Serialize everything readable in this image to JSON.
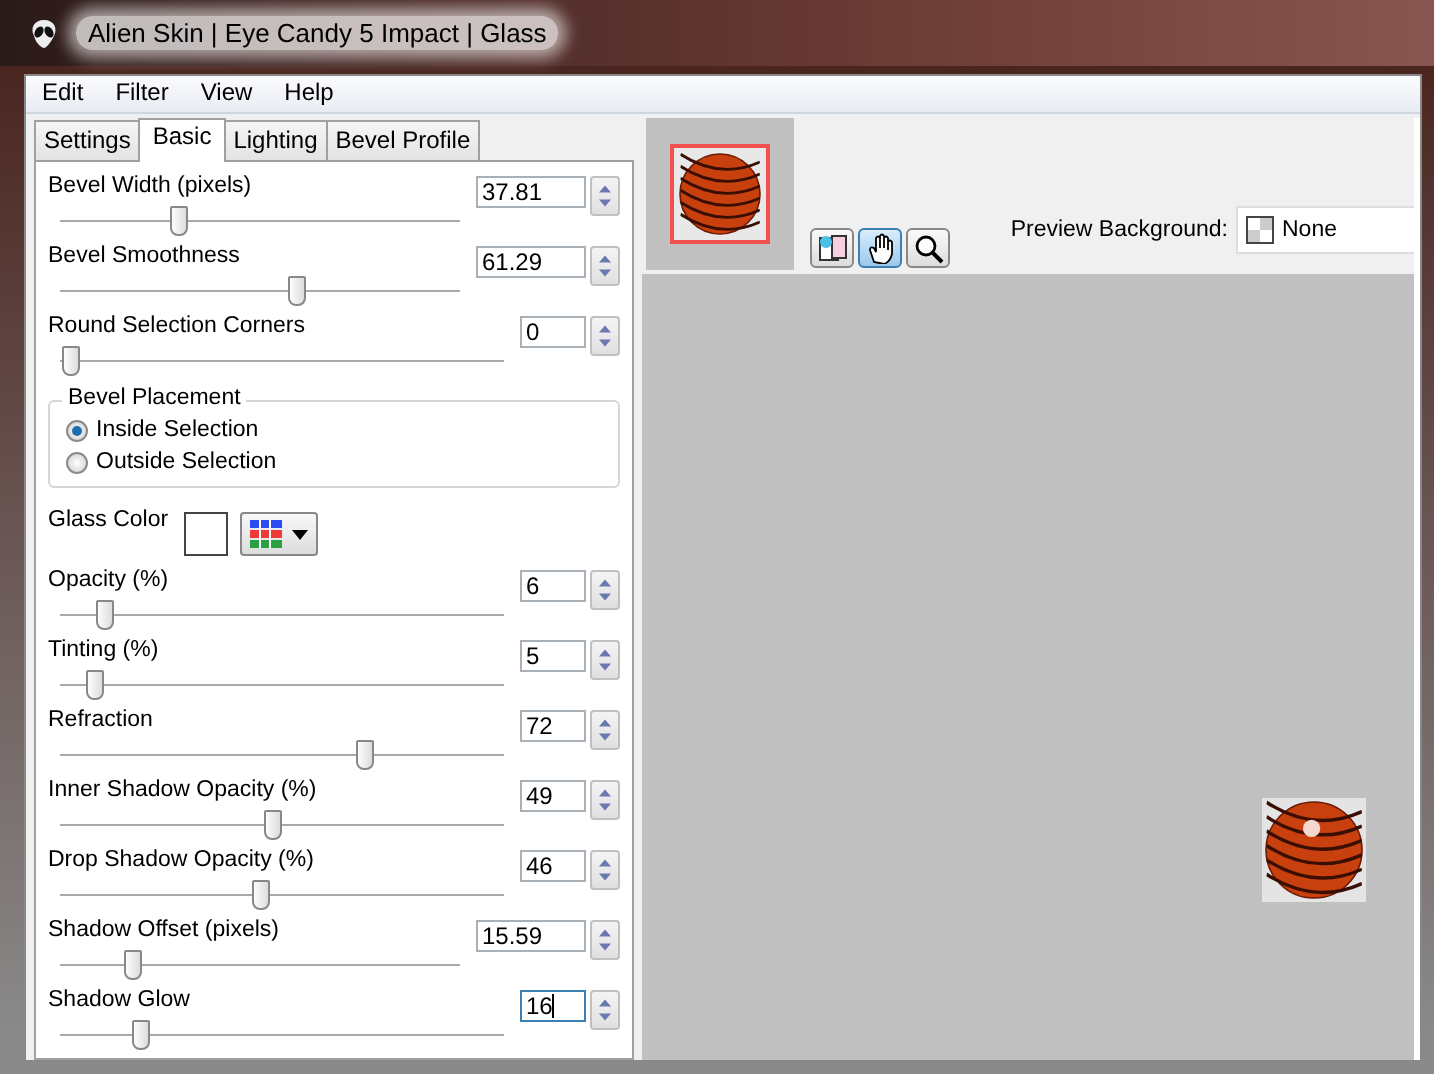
{
  "window": {
    "title": "Alien Skin | Eye Candy 5 Impact | Glass"
  },
  "menu": [
    "Edit",
    "Filter",
    "View",
    "Help"
  ],
  "tabs": [
    {
      "label": "Settings",
      "selected": false
    },
    {
      "label": "Basic",
      "selected": true
    },
    {
      "label": "Lighting",
      "selected": false
    },
    {
      "label": "Bevel Profile",
      "selected": false
    }
  ],
  "controls": [
    {
      "kind": "slider",
      "label": "Bevel Width (pixels)",
      "value": "37.81",
      "level": 0.29,
      "focused": false
    },
    {
      "kind": "slider",
      "label": "Bevel Smoothness",
      "value": "61.29",
      "level": 0.61,
      "focused": false
    },
    {
      "kind": "slider",
      "label": "Round Selection Corners",
      "value": "0",
      "level": 0,
      "focused": false
    },
    {
      "kind": "group",
      "title": "Bevel Placement",
      "options": [
        {
          "label": "Inside Selection",
          "selected": true
        },
        {
          "label": "Outside Selection",
          "selected": false
        }
      ]
    },
    {
      "kind": "color",
      "label": "Glass Color",
      "color": "#ffffff"
    },
    {
      "kind": "slider",
      "label": "Opacity (%)",
      "value": "6",
      "level": 0.08,
      "focused": false
    },
    {
      "kind": "slider",
      "label": "Tinting (%)",
      "value": "5",
      "level": 0.06,
      "focused": false
    },
    {
      "kind": "slider",
      "label": "Refraction",
      "value": "72",
      "level": 0.71,
      "focused": false
    },
    {
      "kind": "slider",
      "label": "Inner Shadow Opacity (%)",
      "value": "49",
      "level": 0.49,
      "focused": false
    },
    {
      "kind": "slider",
      "label": "Drop Shadow Opacity (%)",
      "value": "46",
      "level": 0.46,
      "focused": false
    },
    {
      "kind": "slider",
      "label": "Shadow Offset (pixels)",
      "value": "15.59",
      "level": 0.17,
      "focused": false
    },
    {
      "kind": "slider",
      "label": "Shadow Glow",
      "value": "16",
      "level": 0.17,
      "focused": true
    }
  ],
  "tools": [
    {
      "kind": "compare",
      "selected": false
    },
    {
      "kind": "pan",
      "selected": true
    },
    {
      "kind": "zoom",
      "selected": false
    }
  ],
  "preview": {
    "background_label": "Preview Background:",
    "background_value": "None"
  }
}
